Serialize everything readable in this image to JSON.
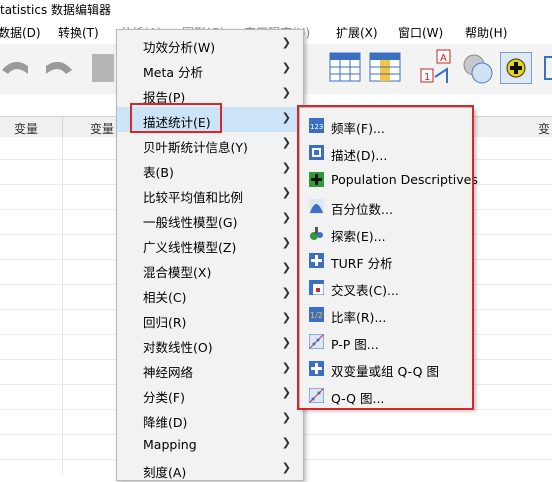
{
  "window": {
    "title": "tatistics 数据编辑器"
  },
  "menubar": {
    "items": [
      {
        "label": "数据(D)"
      },
      {
        "label": "转换(T)"
      },
      {
        "label": "分析(A)"
      },
      {
        "label": "图形(G)"
      },
      {
        "label": "实用程序(U)"
      },
      {
        "label": "扩展(X)"
      },
      {
        "label": "窗口(W)"
      },
      {
        "label": "帮助(H)"
      }
    ]
  },
  "grid": {
    "column_headers": [
      "变量",
      "变量",
      "变"
    ]
  },
  "analyze_menu": {
    "items": [
      {
        "label": "功效分析(W)",
        "has_submenu": true
      },
      {
        "label": "Meta 分析",
        "has_submenu": true
      },
      {
        "label": "报告(P)",
        "has_submenu": true
      },
      {
        "label": "描述统计(E)",
        "has_submenu": true,
        "active": true
      },
      {
        "label": "贝叶斯统计信息(Y)",
        "has_submenu": true
      },
      {
        "label": "表(B)",
        "has_submenu": true
      },
      {
        "label": "比较平均值和比例",
        "has_submenu": true
      },
      {
        "label": "一般线性模型(G)",
        "has_submenu": true
      },
      {
        "label": "广义线性模型(Z)",
        "has_submenu": true
      },
      {
        "label": "混合模型(X)",
        "has_submenu": true
      },
      {
        "label": "相关(C)",
        "has_submenu": true
      },
      {
        "label": "回归(R)",
        "has_submenu": true
      },
      {
        "label": "对数线性(O)",
        "has_submenu": true
      },
      {
        "label": "神经网络",
        "has_submenu": true
      },
      {
        "label": "分类(F)",
        "has_submenu": true
      },
      {
        "label": "降维(D)",
        "has_submenu": true
      },
      {
        "label": "Mapping",
        "has_submenu": true
      },
      {
        "label": "刻度(A)",
        "has_submenu": true
      }
    ]
  },
  "descriptive_submenu": {
    "items": [
      {
        "label": "频率(F)...",
        "icon": "frequencies-icon"
      },
      {
        "label": "描述(D)...",
        "icon": "descriptives-icon"
      },
      {
        "label": "Population Descriptives",
        "icon": "population-descriptives-icon"
      },
      {
        "label": "百分位数...",
        "icon": "percentiles-icon"
      },
      {
        "label": "探索(E)...",
        "icon": "explore-icon"
      },
      {
        "label": "TURF 分析",
        "icon": "turf-icon"
      },
      {
        "label": "交叉表(C)...",
        "icon": "crosstabs-icon"
      },
      {
        "label": "比率(R)...",
        "icon": "ratio-icon"
      },
      {
        "label": "P-P 图...",
        "icon": "pp-plot-icon"
      },
      {
        "label": "双变量或组 Q-Q 图",
        "icon": "bivariate-qq-icon"
      },
      {
        "label": "Q-Q 图...",
        "icon": "qq-plot-icon"
      }
    ]
  },
  "colors": {
    "highlight_border": "#d9262c",
    "menu_bg": "#f2f2f2",
    "active_item_bg": "#cce4f7"
  }
}
